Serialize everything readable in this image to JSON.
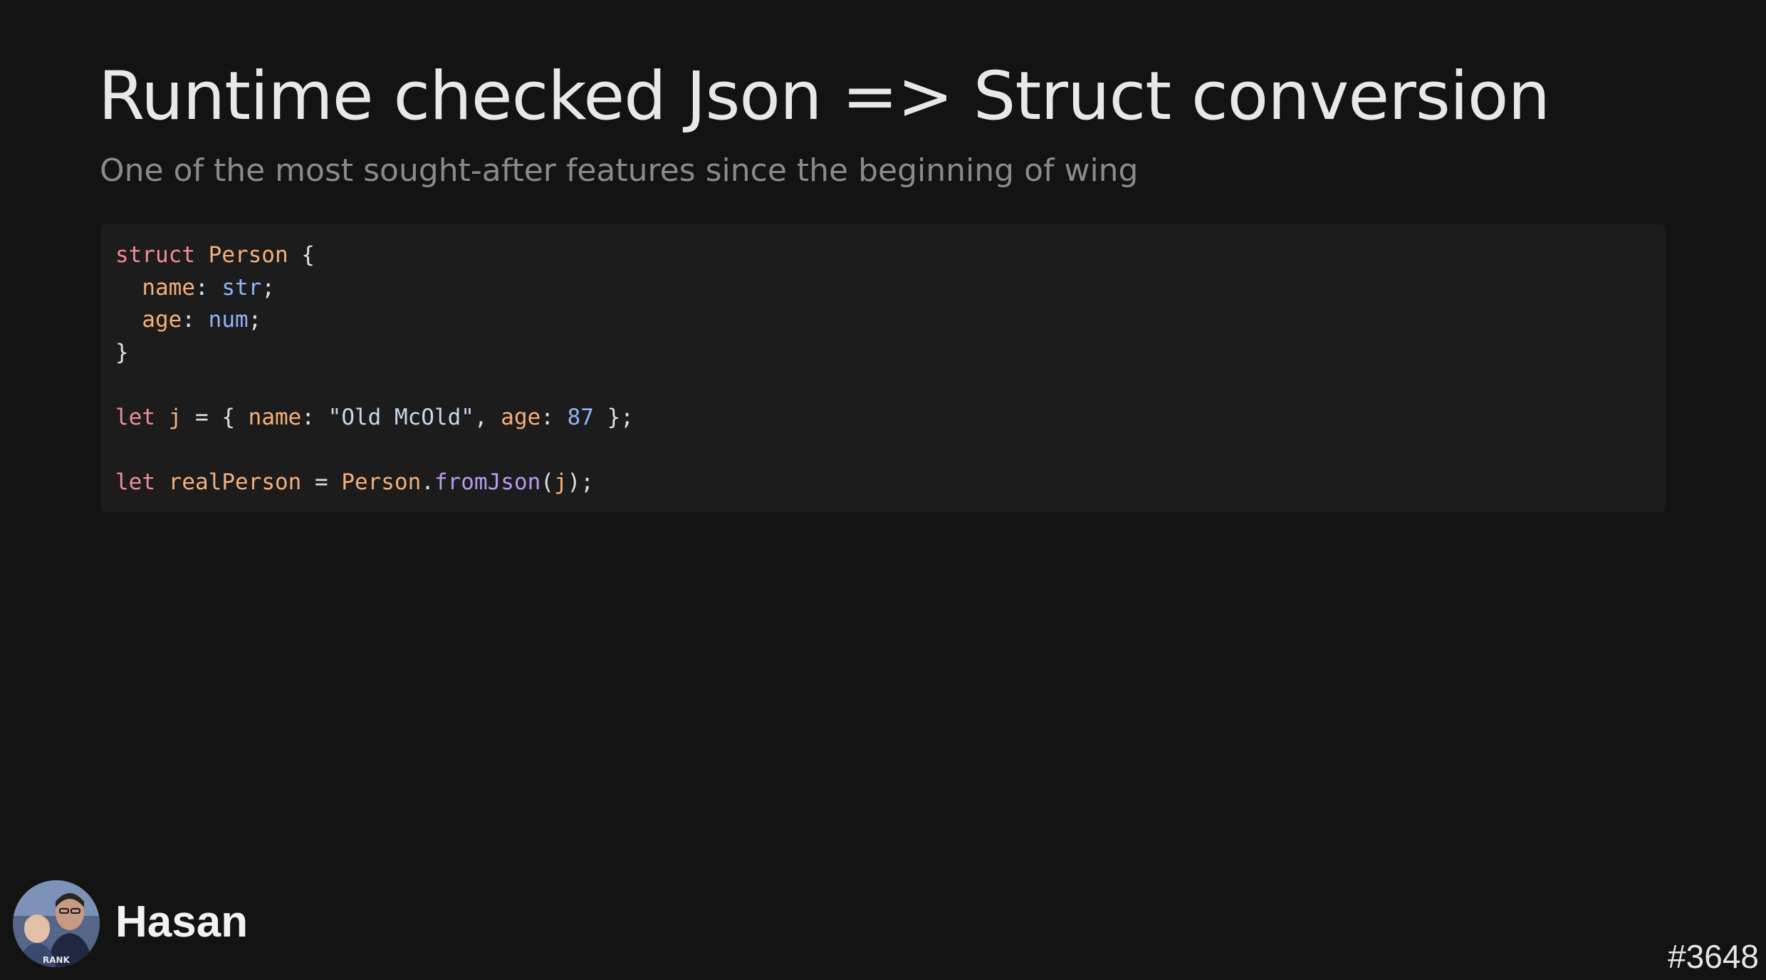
{
  "slide": {
    "title": "Runtime checked Json => Struct conversion",
    "subtitle": "One of the most sought-after features since the beginning of wing"
  },
  "code": {
    "language": "wing",
    "lines": [
      [
        {
          "text": "struct",
          "kind": "keyword"
        },
        {
          "text": " ",
          "kind": "punct"
        },
        {
          "text": "Person",
          "kind": "type"
        },
        {
          "text": " {",
          "kind": "punct"
        }
      ],
      [
        {
          "text": "  ",
          "kind": "punct"
        },
        {
          "text": "name",
          "kind": "prop"
        },
        {
          "text": ": ",
          "kind": "punct"
        },
        {
          "text": "str",
          "kind": "builtin"
        },
        {
          "text": ";",
          "kind": "punct"
        }
      ],
      [
        {
          "text": "  ",
          "kind": "punct"
        },
        {
          "text": "age",
          "kind": "prop"
        },
        {
          "text": ": ",
          "kind": "punct"
        },
        {
          "text": "num",
          "kind": "builtin"
        },
        {
          "text": ";",
          "kind": "punct"
        }
      ],
      [
        {
          "text": "}",
          "kind": "punct"
        }
      ],
      [],
      [
        {
          "text": "let",
          "kind": "keyword"
        },
        {
          "text": " ",
          "kind": "punct"
        },
        {
          "text": "j",
          "kind": "var"
        },
        {
          "text": " = { ",
          "kind": "punct"
        },
        {
          "text": "name",
          "kind": "prop"
        },
        {
          "text": ": ",
          "kind": "punct"
        },
        {
          "text": "\"Old McOld\"",
          "kind": "string"
        },
        {
          "text": ", ",
          "kind": "punct"
        },
        {
          "text": "age",
          "kind": "prop"
        },
        {
          "text": ": ",
          "kind": "punct"
        },
        {
          "text": "87",
          "kind": "number"
        },
        {
          "text": " };",
          "kind": "punct"
        }
      ],
      [],
      [
        {
          "text": "let",
          "kind": "keyword"
        },
        {
          "text": " ",
          "kind": "punct"
        },
        {
          "text": "realPerson",
          "kind": "var"
        },
        {
          "text": " = ",
          "kind": "punct"
        },
        {
          "text": "Person",
          "kind": "type"
        },
        {
          "text": ".",
          "kind": "punct"
        },
        {
          "text": "fromJson",
          "kind": "method"
        },
        {
          "text": "(",
          "kind": "punct"
        },
        {
          "text": "j",
          "kind": "var"
        },
        {
          "text": ");",
          "kind": "punct"
        }
      ]
    ]
  },
  "presenter": {
    "name": "Hasan",
    "avatar_icon": "presenter-photo"
  },
  "footer": {
    "slide_id": "#3648"
  },
  "colors": {
    "background": "#131313",
    "code_background": "#1c1c1c",
    "keyword": "#f08c97",
    "type": "#f5b07a",
    "builtin": "#8fb4f5",
    "method": "#b99af0"
  }
}
